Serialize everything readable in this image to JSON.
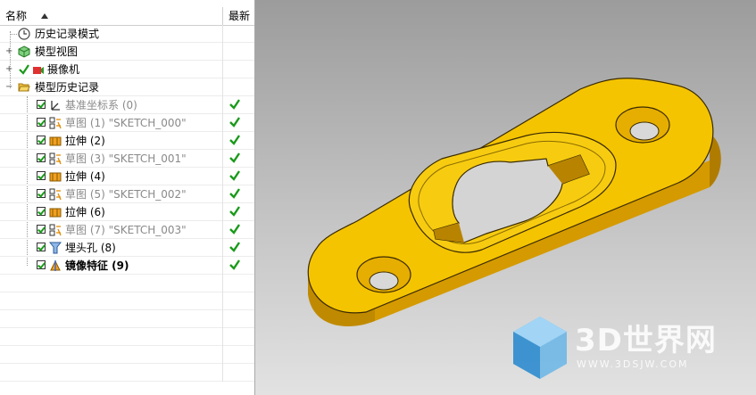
{
  "nav": {
    "header": {
      "name_label": "名称",
      "latest_label": "最新"
    },
    "items": [
      {
        "label": "历史记录模式",
        "icon": "clock-icon"
      },
      {
        "label": "模型视图",
        "icon": "model-view-icon"
      },
      {
        "label": "摄像机",
        "icon": "camera-icon"
      },
      {
        "label": "模型历史记录",
        "icon": "folder-open-icon"
      },
      {
        "label": "基准坐标系 (0)",
        "icon": "datum-csys-icon"
      },
      {
        "label": "草图 (1) \"SKETCH_000\"",
        "icon": "sketch-icon"
      },
      {
        "label": "拉伸 (2)",
        "icon": "extrude-icon"
      },
      {
        "label": "草图 (3) \"SKETCH_001\"",
        "icon": "sketch-icon"
      },
      {
        "label": "拉伸 (4)",
        "icon": "extrude-icon"
      },
      {
        "label": "草图 (5) \"SKETCH_002\"",
        "icon": "sketch-icon"
      },
      {
        "label": "拉伸 (6)",
        "icon": "extrude-icon"
      },
      {
        "label": "草图 (7) \"SKETCH_003\"",
        "icon": "sketch-icon"
      },
      {
        "label": "埋头孔 (8)",
        "icon": "countersink-hole-icon"
      },
      {
        "label": "镜像特征 (9)",
        "icon": "mirror-feature-icon"
      }
    ]
  },
  "viewport": {
    "part_color": "#f5c400",
    "side_color": "#c89100"
  },
  "watermark": {
    "brand": "3D世界网",
    "url": "WWW.3DSJW.COM"
  }
}
